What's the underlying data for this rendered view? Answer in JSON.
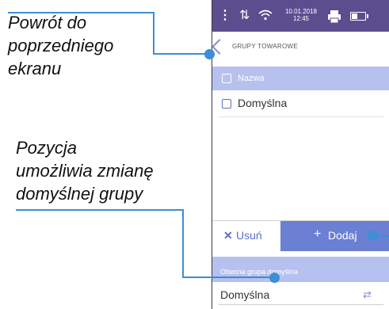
{
  "annotations": {
    "back_note": [
      "Powrót do",
      "poprzedniego",
      "ekranu"
    ],
    "default_group_note": [
      "Pozycja",
      "umożliwia zmianę",
      "domyślnej grupy"
    ]
  },
  "status_bar": {
    "date": "10.01.2018",
    "time": "12:45",
    "icons": [
      "menu-icon",
      "sort-icon",
      "wifi-icon",
      "printer-icon",
      "battery-icon"
    ]
  },
  "header": {
    "title": "GRUPY TOWAROWE"
  },
  "table": {
    "column_header": "Nazwa",
    "rows": [
      {
        "name": "Domyślna"
      }
    ]
  },
  "actions": {
    "delete_label": "Usuń",
    "add_label": "Dodaj"
  },
  "default_group": {
    "label": "Obecna grupa domyślna",
    "value": "Domyślna"
  },
  "colors": {
    "status_bar": "#5b4e8f",
    "accent": "#6b7fd3",
    "accent_light": "#b6c1ef",
    "callout": "#3c8ed6"
  }
}
